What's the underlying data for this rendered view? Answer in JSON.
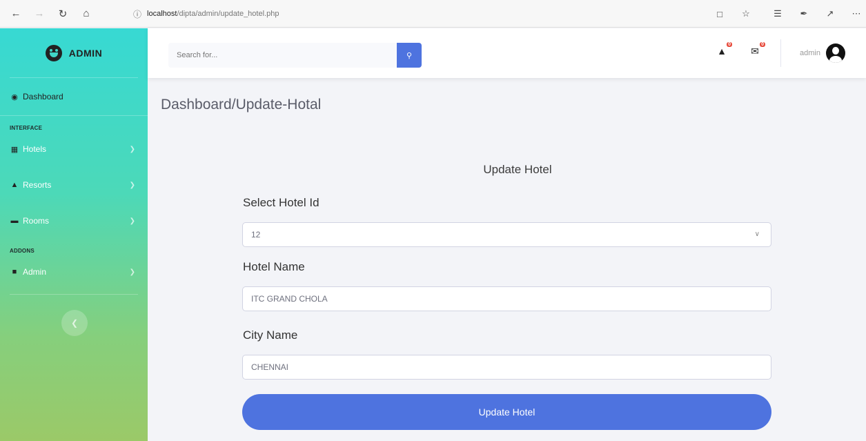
{
  "browser": {
    "url_host": "localhost",
    "url_path": "/dipta/admin/update_hotel.php"
  },
  "sidebar": {
    "brand": "ADMIN",
    "dashboard_label": "Dashboard",
    "interface_heading": "INTERFACE",
    "addons_heading": "ADDONS",
    "items": [
      {
        "label": "Hotels",
        "icon": "hotel-icon"
      },
      {
        "label": "Resorts",
        "icon": "tree-icon"
      },
      {
        "label": "Rooms",
        "icon": "bed-icon"
      },
      {
        "label": "Admin",
        "icon": "folder-icon"
      }
    ]
  },
  "topbar": {
    "search_placeholder": "Search for...",
    "alerts_count": "0",
    "messages_count": "0",
    "user_name": "admin"
  },
  "main": {
    "page_title": "Dashboard/Update-Hotal",
    "form_heading": "Update Hotel",
    "select_label": "Select Hotel Id",
    "select_value": "12",
    "hotel_name_label": "Hotel Name",
    "hotel_name_value": "ITC GRAND CHOLA",
    "city_label": "City Name",
    "city_value": "CHENNAI",
    "submit_label": "Update Hotel"
  },
  "colors": {
    "primary": "#4e73df",
    "sidebar_top": "#37d9d3",
    "sidebar_bottom": "#9bc968",
    "badge": "#e74a3b"
  }
}
